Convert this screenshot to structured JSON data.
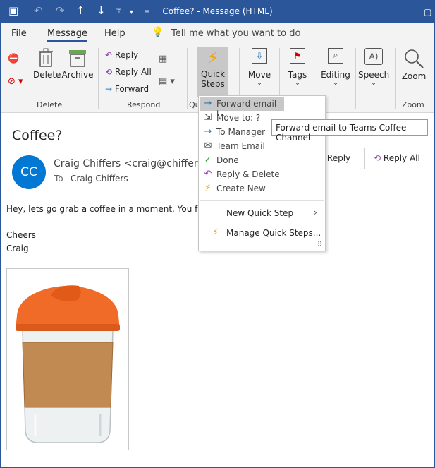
{
  "window": {
    "title": "Coffee? - Message (HTML)"
  },
  "tabs": [
    {
      "label": "File"
    },
    {
      "label": "Message"
    },
    {
      "label": "Help"
    }
  ],
  "tell_me": "Tell me what you want to do",
  "ribbon": {
    "delete_group": {
      "delete": "Delete",
      "archive": "Archive",
      "label": "Delete"
    },
    "respond_group": {
      "reply": "Reply",
      "reply_all": "Reply All",
      "forward": "Forward",
      "label": "Respond"
    },
    "quick_steps": {
      "line1": "Quick",
      "line2": "Steps",
      "group_label": "Qu"
    },
    "move": "Move",
    "tags": "Tags",
    "editing": "Editing",
    "speech": "Speech",
    "zoom": "Zoom",
    "zoom_group": "Zoom"
  },
  "message": {
    "subject": "Coffee?",
    "avatar_initials": "CC",
    "from": "Craig Chiffers <craig@chiffers.c",
    "to_label": "To",
    "to": "Craig Chiffers",
    "body_line1": "Hey, lets go grab a coffee in a moment. You fr",
    "body_line2": "Cheers",
    "body_line3": "Craig",
    "reply_btn": "Reply",
    "reply_all_btn": "Reply All"
  },
  "quick_steps_menu": {
    "items": [
      {
        "label": "Forward email t..."
      },
      {
        "label": "Move to: ?"
      },
      {
        "label": "To Manager"
      },
      {
        "label": "Team Email"
      },
      {
        "label": "Done"
      },
      {
        "label": "Reply & Delete"
      },
      {
        "label": "Create New"
      }
    ],
    "new_quick_step": "New Quick Step",
    "manage_quick_steps": "Manage Quick Steps..."
  },
  "tooltip": "Forward email to Teams Coffee Channel",
  "colors": {
    "accent": "#2b579a",
    "avatar": "#0078d4",
    "cup_lid": "#f06a28",
    "cork": "#c08a52"
  }
}
